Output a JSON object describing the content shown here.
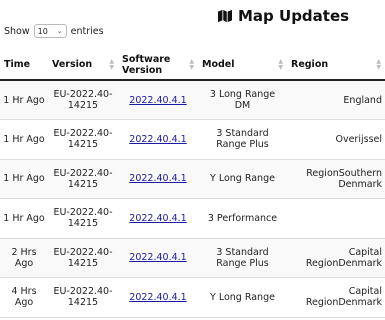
{
  "page": {
    "title": "Map Updates",
    "title_icon": "map-icon"
  },
  "length_control": {
    "prefix": "Show",
    "selected": "10",
    "suffix": "entries"
  },
  "table": {
    "headers": [
      "Time",
      "Version",
      "Software Version",
      "Model",
      "Region"
    ],
    "rows": [
      {
        "time": "1 Hr Ago",
        "version": "EU-2022.40-14215",
        "software": "2022.40.4.1",
        "model": "3 Long Range DM",
        "region": "England"
      },
      {
        "time": "1 Hr Ago",
        "version": "EU-2022.40-14215",
        "software": "2022.40.4.1",
        "model": "3 Standard Range Plus",
        "region": "Overijssel"
      },
      {
        "time": "1 Hr Ago",
        "version": "EU-2022.40-14215",
        "software": "2022.40.4.1",
        "model": "Y Long Range",
        "region": "RegionSouthern Denmark"
      },
      {
        "time": "1 Hr Ago",
        "version": "EU-2022.40-14215",
        "software": "2022.40.4.1",
        "model": "3 Performance",
        "region": ""
      },
      {
        "time": "2 Hrs Ago",
        "version": "EU-2022.40-14215",
        "software": "2022.40.4.1",
        "model": "3 Standard Range Plus",
        "region": "Capital RegionDenmark"
      },
      {
        "time": "4 Hrs Ago",
        "version": "EU-2022.40-14215",
        "software": "2022.40.4.1",
        "model": "Y Long Range",
        "region": "Capital RegionDenmark"
      }
    ]
  }
}
